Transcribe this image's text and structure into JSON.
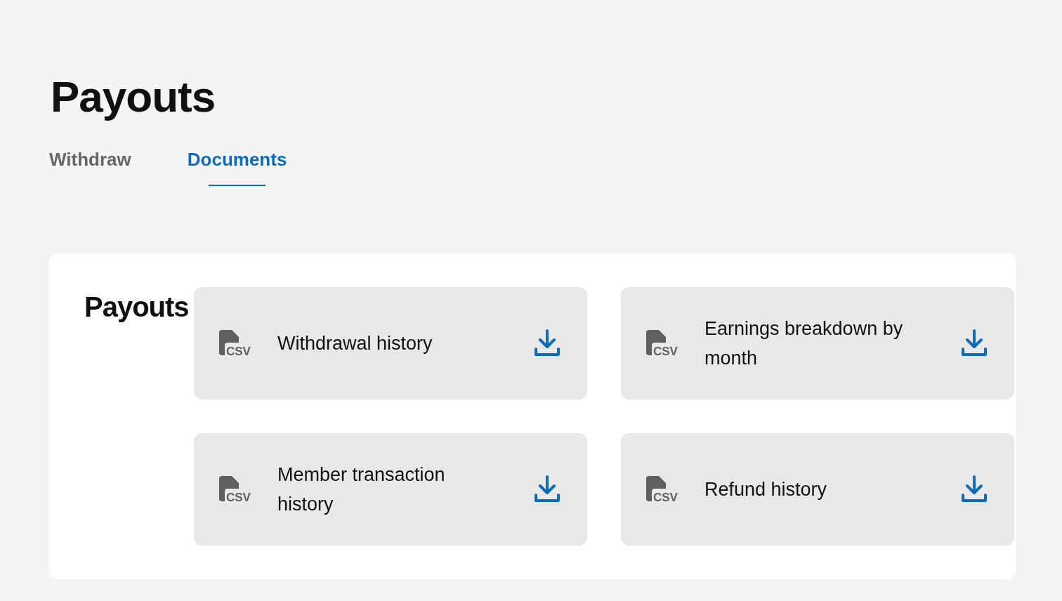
{
  "page_title": "Payouts",
  "tabs": [
    {
      "label": "Withdraw",
      "selected": false
    },
    {
      "label": "Documents",
      "selected": true
    }
  ],
  "section": {
    "heading": "Payouts",
    "documents": [
      {
        "name": "Withdrawal history",
        "file_type": "CSV"
      },
      {
        "name": "Earnings breakdown by month",
        "file_type": "CSV"
      },
      {
        "name": "Member transaction history",
        "file_type": "CSV"
      },
      {
        "name": "Refund history",
        "file_type": "CSV"
      }
    ]
  }
}
